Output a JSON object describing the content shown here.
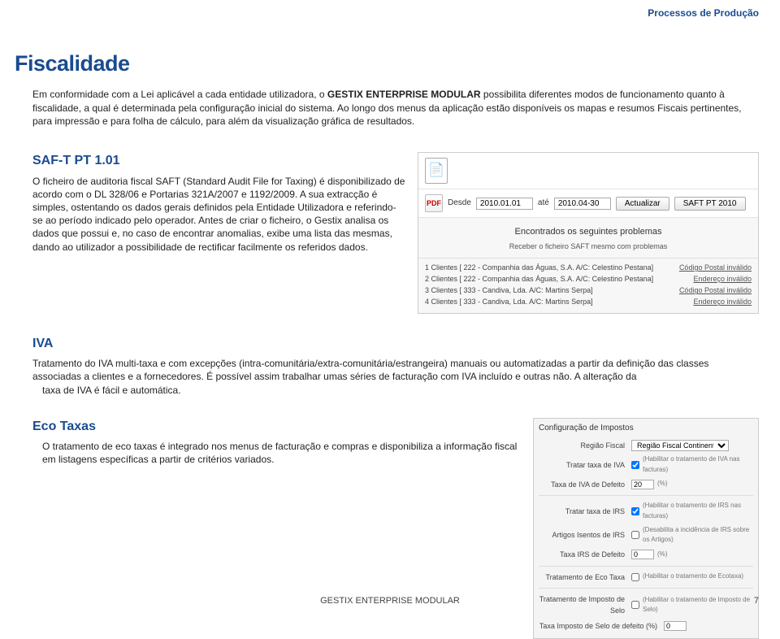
{
  "header": {
    "breadcrumb": "Processos de Produção"
  },
  "page_title": "Fiscalidade",
  "intro_html": "Em conformidade com a Lei aplicável a cada entidade utilizadora, o GESTIX ENTERPRISE MODULAR possibilita diferentes modos de funcionamento quanto à fiscalidade, a qual é determinada pela configuração inicial do sistema. Ao longo dos menus da aplicação estão disponíveis os mapas e resumos Fiscais pertinentes, para impressão e para folha de cálculo, para além da visualização gráfica de resultados.",
  "saft": {
    "heading": "SAF-T PT 1.01",
    "body": "O ficheiro de auditoria fiscal SAFT (Standard Audit File for Taxing) é disponibilizado de acordo com o DL 328/06 e Portarias 321A/2007 e 1192/2009. A sua extracção é simples, ostentando os dados gerais definidos pela Entidade Utilizadora e referindo-se ao período indicado pelo operador. Antes de criar o ficheiro, o Gestix analisa os dados que possui e, no caso de encontrar anomalias, exibe uma lista das mesmas, dando ao utilizador a possibilidade de rectificar facilmente os referidos dados.",
    "panel": {
      "desde_label": "Desde",
      "ate_label": "até",
      "date_from": "2010.01.01",
      "date_to": "2010.04-30",
      "actualizar": "Actualizar",
      "saft_btn": "SAFT PT 2010",
      "found_msg": "Encontrados os seguintes problemas",
      "recv_msg": "Receber o ficheiro SAFT mesmo com problemas",
      "rows": [
        {
          "n": "1",
          "text": "Clientes [ 222 - Companhia das Águas, S.A. A/C: Celestino Pestana]",
          "err": "Código Postal inválido"
        },
        {
          "n": "2",
          "text": "Clientes [ 222 - Companhia das Águas, S.A. A/C: Celestino Pestana]",
          "err": "Endereço inválido"
        },
        {
          "n": "3",
          "text": "Clientes [ 333 - Candiva, Lda. A/C: Martins Serpa]",
          "err": "Código Postal inválido"
        },
        {
          "n": "4",
          "text": "Clientes [ 333 - Candiva, Lda. A/C: Martins Serpa]",
          "err": "Endereço inválido"
        }
      ]
    }
  },
  "iva": {
    "heading": "IVA",
    "body": "Tratamento do IVA multi-taxa e com excepções (intra-comunitária/extra-comunitária/estrangeira) manuais ou automatizadas a partir da definição das classes associadas a clientes e a fornecedores. É possível assim trabalhar umas séries de facturação com IVA incluído e outras não. A alteração da taxa de IVA é fácil e automática."
  },
  "eco": {
    "heading": "Eco Taxas",
    "body": "O tratamento de eco taxas é integrado nos menus de facturação e compras e disponibiliza a informação fiscal em listagens específicas a partir de critérios variados."
  },
  "config": {
    "title": "Configuração de Impostos",
    "regiao_lbl": "Região Fiscal",
    "regiao_val": "Região Fiscal Continente",
    "iva_lbl": "Tratar taxa de IVA",
    "iva_hint": "(Habilitar o tratamento de IVA nas facturas)",
    "iva_def_lbl": "Taxa de IVA de Defeito",
    "iva_def_val": "20",
    "pct": "(%)",
    "irs_lbl": "Tratar taxa de IRS",
    "irs_hint": "(Habilitar o tratamento de IRS nas facturas)",
    "irs_art_lbl": "Artigos Isentos de IRS",
    "irs_art_hint": "(Desabilita a incidência de IRS sobre os Artigos)",
    "irs_def_lbl": "Taxa IRS de Defeito",
    "irs_def_val": "0",
    "eco_lbl": "Tratamento de Eco Taxa",
    "eco_hint": "(Habilitar o tratamento de Ecotaxa)",
    "selo_lbl": "Tratamento de Imposto de Selo",
    "selo_hint": "(Habilitar o tratamento de Imposto de Selo)",
    "selo_def_lbl": "Taxa Imposto de Selo de defeito (%)",
    "selo_def_val": "0"
  },
  "footer": {
    "product": "GESTIX ENTERPRISE MODULAR",
    "page": "7"
  }
}
